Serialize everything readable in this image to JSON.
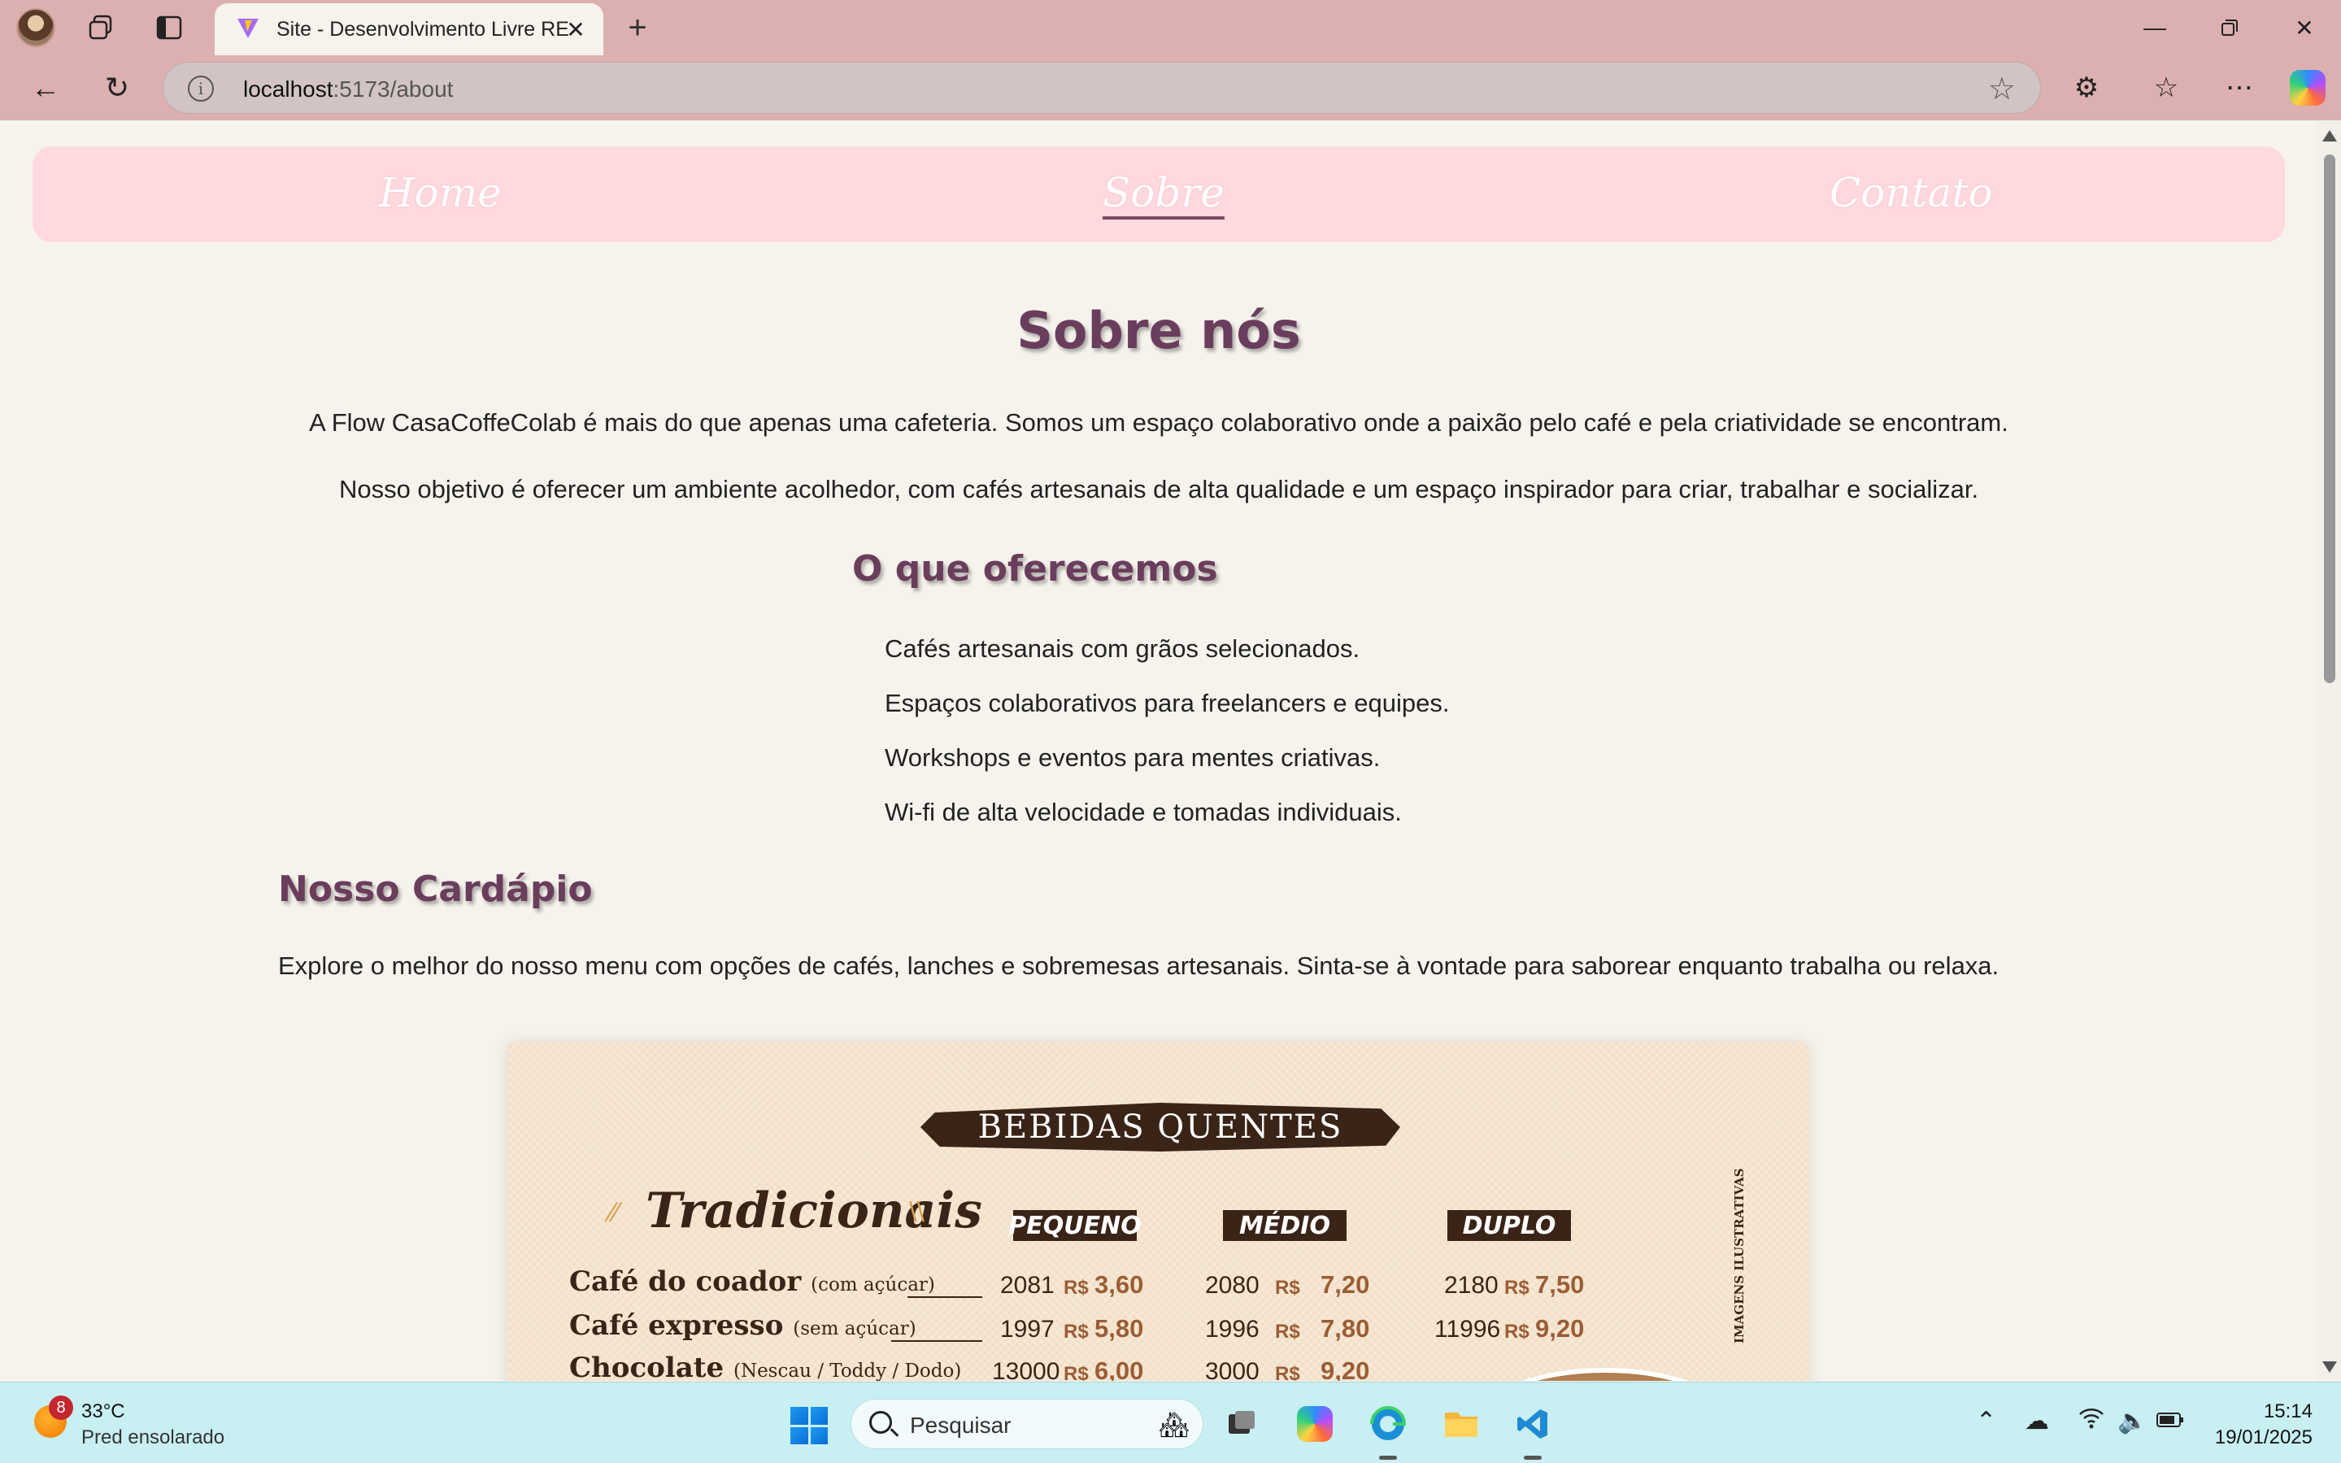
{
  "browser": {
    "tab_title": "Site - Desenvolvimento Livre REACT",
    "url_host": "localhost",
    "url_path": ":5173/about"
  },
  "nav": {
    "home": "Home",
    "about": "Sobre",
    "contact": "Contato"
  },
  "about": {
    "title": "Sobre nós",
    "p1": "A Flow CasaCoffeColab é mais do que apenas uma cafeteria. Somos um espaço colaborativo onde a paixão pelo café e pela criatividade se encontram.",
    "p2": "Nosso objetivo é oferecer um ambiente acolhedor, com cafés artesanais de alta qualidade e um espaço inspirador para criar, trabalhar e socializar.",
    "offer_title": "O que oferecemos",
    "offers": [
      "Cafés artesanais com grãos selecionados.",
      "Espaços colaborativos para freelancers e equipes.",
      "Workshops e eventos para mentes criativas.",
      "Wi-fi de alta velocidade e tomadas individuais."
    ],
    "menu_title": "Nosso Cardápio",
    "menu_intro": "Explore o melhor do nosso menu com opções de cafés, lanches e sobremesas artesanais. Sinta-se à vontade para saborear enquanto trabalha ou relaxa."
  },
  "menu_image": {
    "banner": "BEBIDAS QUENTES",
    "section": "Tradicionais",
    "sizes": [
      "PEQUENO",
      "MÉDIO",
      "DUPLO"
    ],
    "side_note": "IMAGENS ILUSTRATIVAS",
    "currency": "R$",
    "rows": [
      {
        "name": "Café do coador",
        "note": "(com açúcar)",
        "codes": [
          "2081",
          "2080",
          "2180"
        ],
        "prices": [
          "3,60",
          "7,20",
          "7,50"
        ]
      },
      {
        "name": "Café expresso",
        "note": "(sem açúcar)",
        "codes": [
          "1997",
          "1996",
          "11996"
        ],
        "prices": [
          "5,80",
          "7,80",
          "9,20"
        ]
      },
      {
        "name": "Chocolate",
        "note": "(Nescau / Toddy / Dodo)",
        "codes": [
          "13000",
          "3000",
          ""
        ],
        "prices": [
          "6,00",
          "9,20",
          ""
        ]
      }
    ]
  },
  "taskbar": {
    "weather_badge": "8",
    "temperature": "33°C",
    "condition": "Pred ensolarado",
    "search_placeholder": "Pesquisar",
    "time": "15:14",
    "date": "19/01/2025"
  }
}
